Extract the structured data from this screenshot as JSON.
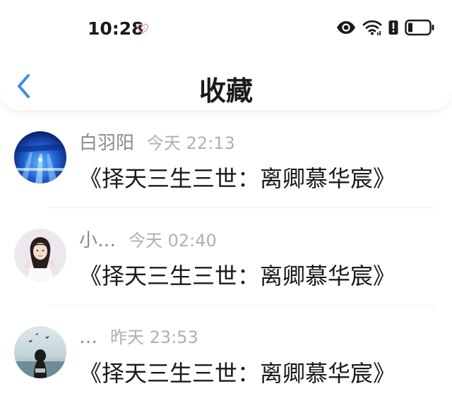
{
  "status_bar": {
    "time": "10:28",
    "icons": [
      "heart-icon",
      "eye-icon",
      "wifi-icon",
      "battery-alert-icon",
      "battery-icon"
    ]
  },
  "nav": {
    "title": "收藏",
    "back_icon": "chevron-left-icon"
  },
  "colors": {
    "accent": "#3a8ee6",
    "text_primary": "#1a1a1a",
    "text_secondary": "#8a8a8a",
    "text_time": "#b0b0b0"
  },
  "favorites": [
    {
      "sender": "白羽阳",
      "time": "今天 22:13",
      "message": "《择天三生三世：离卿慕华宸》",
      "avatar": "blue-stage-avatar"
    },
    {
      "sender": "小…",
      "time": "今天 02:40",
      "message": "《择天三生三世：离卿慕华宸》",
      "avatar": "girl-portrait-avatar"
    },
    {
      "sender": "…",
      "time": "昨天 23:53",
      "message": "《择天三生三世：离卿慕华宸》",
      "avatar": "seaside-avatar"
    }
  ]
}
